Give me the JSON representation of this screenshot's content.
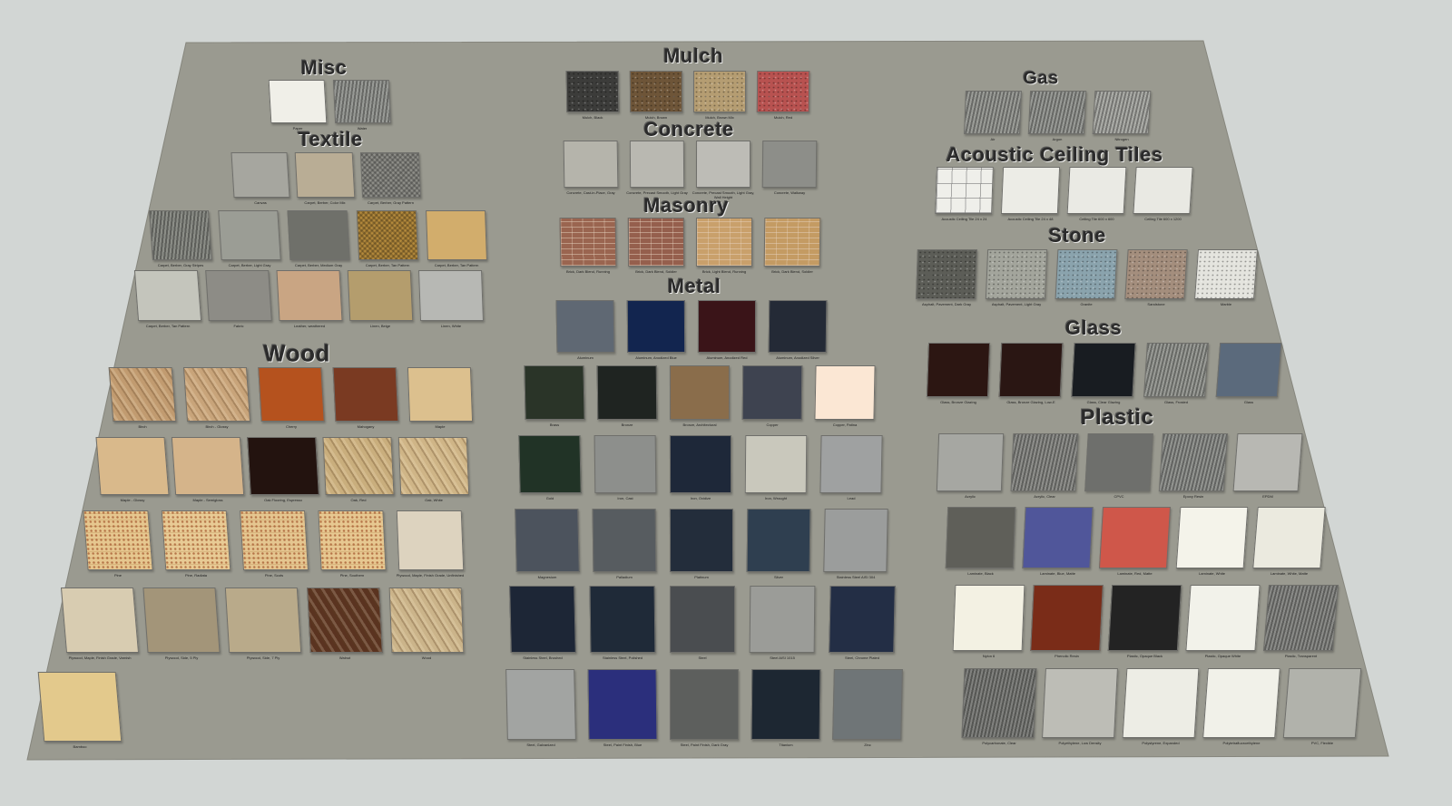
{
  "sections": [
    {
      "title": "Misc",
      "items": [
        {
          "label": "Paper",
          "color": "#f0efe8"
        },
        {
          "label": "Water",
          "color": "#8a8c88",
          "pattern": "stripes"
        }
      ]
    },
    {
      "title": "Textile",
      "items": [
        {
          "label": "Canvas",
          "color": "#a6a69f"
        },
        {
          "label": "Carpet, Berber, Color Mix",
          "color": "#b9ad95"
        },
        {
          "label": "Carpet, Berber, Gray Pattern",
          "color": "#8f8f89",
          "pattern": "weave"
        },
        {
          "label": "Carpet, Berber, Gray Stripes",
          "color": "#7b7d76",
          "pattern": "stripes"
        },
        {
          "label": "Carpet, Berber, Light Gray",
          "color": "#9b9d95"
        },
        {
          "label": "Carpet, Berber, Medium Gray",
          "color": "#6f706a"
        },
        {
          "label": "Carpet, Berber, Tan Pattern",
          "color": "#b48a3c",
          "pattern": "weave"
        },
        {
          "label": "Carpet, Berber, Tan Pattern",
          "color": "#d2ad6c"
        },
        {
          "label": "Carpet, Berber, Tan Pattern",
          "color": "#c4c5bc"
        },
        {
          "label": "Fabric",
          "color": "#8d8c86"
        },
        {
          "label": "Leather, weathered",
          "color": "#c9a583"
        },
        {
          "label": "Linen, Beige",
          "color": "#b49d6d"
        },
        {
          "label": "Linen, White",
          "color": "#b7b8b4"
        }
      ]
    },
    {
      "title": "Wood",
      "items": [
        {
          "label": "Birch",
          "color": "#c19b70",
          "pattern": "grain"
        },
        {
          "label": "Birch - Glossy",
          "color": "#c8a47a",
          "pattern": "grain"
        },
        {
          "label": "Cherry",
          "color": "#b5521e"
        },
        {
          "label": "Mahogany",
          "color": "#7a3a22"
        },
        {
          "label": "Maple",
          "color": "#dcc08e"
        },
        {
          "label": "Maple - Glossy",
          "color": "#d9b98b"
        },
        {
          "label": "Maple - Semigloss",
          "color": "#d5b48a"
        },
        {
          "label": "Oak Flooring, Espresso",
          "color": "#23130f"
        },
        {
          "label": "Oak, Red",
          "color": "#c9ae7d",
          "pattern": "grain"
        },
        {
          "label": "Oak, White",
          "color": "#cfb587",
          "pattern": "grain"
        },
        {
          "label": "Pine",
          "color": "#e6c78f",
          "pattern": "dots"
        },
        {
          "label": "Pine, Radiata",
          "color": "#e8cb95",
          "pattern": "dots"
        },
        {
          "label": "Pine, Scots",
          "color": "#e5c690",
          "pattern": "dots"
        },
        {
          "label": "Pine, Southern",
          "color": "#e7c891",
          "pattern": "dots"
        },
        {
          "label": "Plywood, Maple, Finish Grade, Unfinished",
          "color": "#ddd3bf"
        },
        {
          "label": "Plywood, Maple, Finish Grade, Varnish",
          "color": "#d8ccb1"
        },
        {
          "label": "Plywood, Side, 5 Ply",
          "color": "#a39579"
        },
        {
          "label": "Plywood, Side, 7 Ply",
          "color": "#b9aa8a"
        },
        {
          "label": "Walnut",
          "color": "#5a3320",
          "pattern": "grain"
        },
        {
          "label": "Wood",
          "color": "#cbb48a",
          "pattern": "grain"
        },
        {
          "label": "Bamboo",
          "color": "#e3c98c"
        }
      ]
    },
    {
      "title": "Mulch",
      "items": [
        {
          "label": "Mulch, Black",
          "color": "#3c3c3a",
          "pattern": "speckle"
        },
        {
          "label": "Mulch, Brown",
          "color": "#6e5538",
          "pattern": "speckle"
        },
        {
          "label": "Mulch, Brown Mix",
          "color": "#b59d72",
          "pattern": "speckle"
        },
        {
          "label": "Mulch, Red",
          "color": "#b85250",
          "pattern": "speckle"
        }
      ]
    },
    {
      "title": "Concrete",
      "items": [
        {
          "label": "Concrete, Cast-in-Place, Gray",
          "color": "#b5b4ab"
        },
        {
          "label": "Concrete, Precast Smooth, Light Gray",
          "color": "#b9b8b1"
        },
        {
          "label": "Concrete, Precast Smooth, Light Gray, Wall Height",
          "color": "#bdbcb6"
        },
        {
          "label": "Concrete, Walkway",
          "color": "#8d8e89"
        }
      ]
    },
    {
      "title": "Masonry",
      "items": [
        {
          "label": "Brick, Dark Blend, Running",
          "color": "#9a6550",
          "pattern": "brick"
        },
        {
          "label": "Brick, Dark Blend, Soldier",
          "color": "#955f4d",
          "pattern": "brick"
        },
        {
          "label": "Brick, Light Blend, Running",
          "color": "#c9a06b",
          "pattern": "brick"
        },
        {
          "label": "Brick, Dark Blend, Soldier",
          "color": "#c49b63",
          "pattern": "brick"
        }
      ]
    },
    {
      "title": "Metal",
      "items": [
        {
          "label": "Aluminum",
          "color": "#5f6873"
        },
        {
          "label": "Aluminum, Anodized Blue",
          "color": "#12254f"
        },
        {
          "label": "Aluminum, Anodized Red",
          "color": "#3a1418"
        },
        {
          "label": "Aluminum, Anodized Silver",
          "color": "#242a36"
        },
        {
          "label": "Brass",
          "color": "#2a3428"
        },
        {
          "label": "Bronze",
          "color": "#1f2421"
        },
        {
          "label": "Bronze, Architectural",
          "color": "#8a6d4b"
        },
        {
          "label": "Copper",
          "color": "#3e4350"
        },
        {
          "label": "Copper, Patina",
          "color": "#fbe7d4"
        },
        {
          "label": "Gold",
          "color": "#213326"
        },
        {
          "label": "Iron, Cast",
          "color": "#8d8f8c"
        },
        {
          "label": "Iron, Oxidize",
          "color": "#1e2839"
        },
        {
          "label": "Iron, Wrought",
          "color": "#c9c8bc"
        },
        {
          "label": "Lead",
          "color": "#9fa1a1"
        },
        {
          "label": "Magnesium",
          "color": "#4c535d"
        },
        {
          "label": "Palladium",
          "color": "#575c60"
        },
        {
          "label": "Platinum",
          "color": "#232d3b"
        },
        {
          "label": "Silver",
          "color": "#2f3f50"
        },
        {
          "label": "Stainless Steel AISI 304",
          "color": "#9b9d9c"
        },
        {
          "label": "Stainless Steel, Brushed",
          "color": "#1d2636"
        },
        {
          "label": "Stainless Steel, Polished",
          "color": "#1f2a38"
        },
        {
          "label": "Steel",
          "color": "#4a4d50"
        },
        {
          "label": "Steel AISI 1015",
          "color": "#9b9c98"
        },
        {
          "label": "Steel, Chrome Plated",
          "color": "#232e45"
        },
        {
          "label": "Steel, Galvanized",
          "color": "#a2a4a2"
        },
        {
          "label": "Steel, Paint Finish, Blue",
          "color": "#2b2f7c"
        },
        {
          "label": "Steel, Paint Finish, Dark Gray",
          "color": "#5d5f5d"
        },
        {
          "label": "Titanium",
          "color": "#1d2732"
        },
        {
          "label": "Zinc",
          "color": "#6f7577"
        }
      ]
    },
    {
      "title": "Gas",
      "items": [
        {
          "label": "Air",
          "color": "#8c8e89",
          "pattern": "stripes"
        },
        {
          "label": "Argon",
          "color": "#8a8c87",
          "pattern": "stripes"
        },
        {
          "label": "Nitrogen",
          "color": "#9fa09b",
          "pattern": "stripes"
        }
      ]
    },
    {
      "title": "Acoustic Ceiling Tiles",
      "items": [
        {
          "label": "Acoustic Ceiling Tile 24 x 24",
          "color": "#efefea",
          "pattern": "grid"
        },
        {
          "label": "Acoustic Ceiling Tile 24 x 48",
          "color": "#ecece6"
        },
        {
          "label": "Ceiling Tile 600 x 600",
          "color": "#eaeae4"
        },
        {
          "label": "Ceiling Tile 600 x 1200",
          "color": "#e9e9e3"
        }
      ]
    },
    {
      "title": "Stone",
      "items": [
        {
          "label": "Asphalt, Pavement, Dark Gray",
          "color": "#5c5d57",
          "pattern": "speckle"
        },
        {
          "label": "Asphalt, Pavement, Light Gray",
          "color": "#a3a59c",
          "pattern": "speckle"
        },
        {
          "label": "Granite",
          "color": "#8aa3ad",
          "pattern": "speckle"
        },
        {
          "label": "Sandstone",
          "color": "#a48e7d",
          "pattern": "speckle"
        },
        {
          "label": "Marble",
          "color": "#e4e4de",
          "pattern": "speckle"
        }
      ]
    },
    {
      "title": "Glass",
      "items": [
        {
          "label": "Glass, Bronze Glazing",
          "color": "#2c1612"
        },
        {
          "label": "Glass, Bronze Glazing, Low-E",
          "color": "#2a1613"
        },
        {
          "label": "Glass, Clear Glazing",
          "color": "#181c21"
        },
        {
          "label": "Glass, Frosted",
          "color": "#8b8d88",
          "pattern": "stripes"
        },
        {
          "label": "Glass",
          "color": "#5b6a7c"
        }
      ]
    },
    {
      "title": "Plastic",
      "items": [
        {
          "label": "Acrylic",
          "color": "#a6a7a2"
        },
        {
          "label": "Acrylic, Clear",
          "color": "#7e7f7b",
          "pattern": "stripes"
        },
        {
          "label": "CPVC",
          "color": "#6e6f6c"
        },
        {
          "label": "Epoxy Resin",
          "color": "#838581",
          "pattern": "stripes"
        },
        {
          "label": "EPDM",
          "color": "#b8b8b3"
        },
        {
          "label": "Laminate, Black",
          "color": "#5f5f59"
        },
        {
          "label": "Laminate, Blue, Matte",
          "color": "#50569a"
        },
        {
          "label": "Laminate, Red, Matte",
          "color": "#cf574a"
        },
        {
          "label": "Laminate, White",
          "color": "#f4f3ea"
        },
        {
          "label": "Laminate, White, Matte",
          "color": "#ebeadf"
        },
        {
          "label": "Nylon 6",
          "color": "#f3f1e3"
        },
        {
          "label": "Phenolic Resin",
          "color": "#7a2c18"
        },
        {
          "label": "Plastic, Opaque Black",
          "color": "#232323"
        },
        {
          "label": "Plastic, Opaque White",
          "color": "#f2f2ea"
        },
        {
          "label": "Plastic, Transparent",
          "color": "#7a7b77",
          "pattern": "stripes"
        },
        {
          "label": "Polycarbonate, Clear",
          "color": "#6f706c",
          "pattern": "stripes"
        },
        {
          "label": "Polyethylene, Low Density",
          "color": "#bdbdb6"
        },
        {
          "label": "Polystyrene, Expanded",
          "color": "#ededE5"
        },
        {
          "label": "Polytetrafluoroethylene",
          "color": "#f1f1e9"
        },
        {
          "label": "PVC, Flexible",
          "color": "#b1b2ab"
        }
      ]
    }
  ],
  "colors": {
    "background": "#d2d6d4",
    "board": "#9a9a90",
    "board_edge": "#86867d",
    "title_text": "#2b2b2b"
  }
}
